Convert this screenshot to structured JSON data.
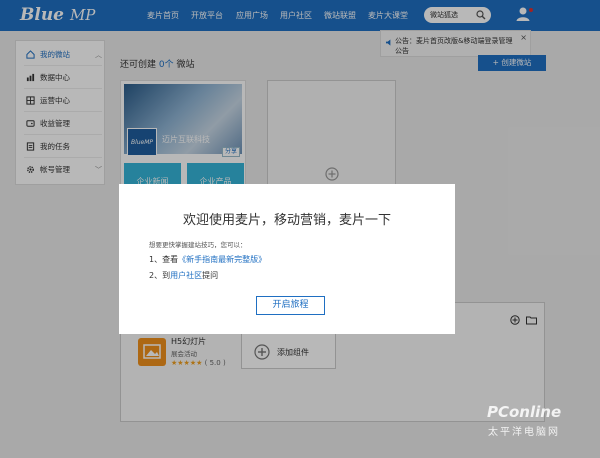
{
  "brand": {
    "logo_main": "Blue",
    "logo_accent": "MP"
  },
  "nav": {
    "items": [
      "麦片首页",
      "开放平台",
      "应用广场",
      "用户社区",
      "微站联盟",
      "麦片大课堂"
    ]
  },
  "search": {
    "text": "微站狐选"
  },
  "notice": {
    "text": "公告：麦片首页改版&移动端登录管理公告",
    "close": "×"
  },
  "sidebar": {
    "items": [
      {
        "label": "我的微站"
      },
      {
        "label": "数据中心"
      },
      {
        "label": "运营中心"
      },
      {
        "label": "收益管理"
      },
      {
        "label": "我的任务"
      },
      {
        "label": "帐号管理"
      }
    ]
  },
  "main": {
    "title_prefix": "还可创建",
    "title_count": "0个",
    "title_suffix": "微站",
    "create_button": "+ 创建微站"
  },
  "card": {
    "logo": "BlueMP",
    "name": "迈片互联科技",
    "share": "分享",
    "tiles": [
      "企业新闻",
      "企业产品"
    ]
  },
  "widget": {
    "name": "H5幻灯片",
    "desc": "展会活动",
    "stars": "★★★★★",
    "rating": "( 5.0 )",
    "add_label": "添加组件"
  },
  "modal": {
    "title": "欢迎使用麦片，移动营销，麦片一下",
    "intro": "想要更快掌握建站技巧，您可以：",
    "step1_prefix": "1、查看",
    "step1_link": "《新手指南最新完整版》",
    "step2_prefix": "2、到",
    "step2_link": "用户社区",
    "step2_suffix": "提问",
    "start_button": "开启旅程"
  },
  "watermark": {
    "main": "PConline",
    "sub": "太平洋电脑网"
  },
  "colors": {
    "brand_blue": "#1f6fc2",
    "tile_cyan": "#35b5d8",
    "widget_orange": "#f0901c"
  }
}
